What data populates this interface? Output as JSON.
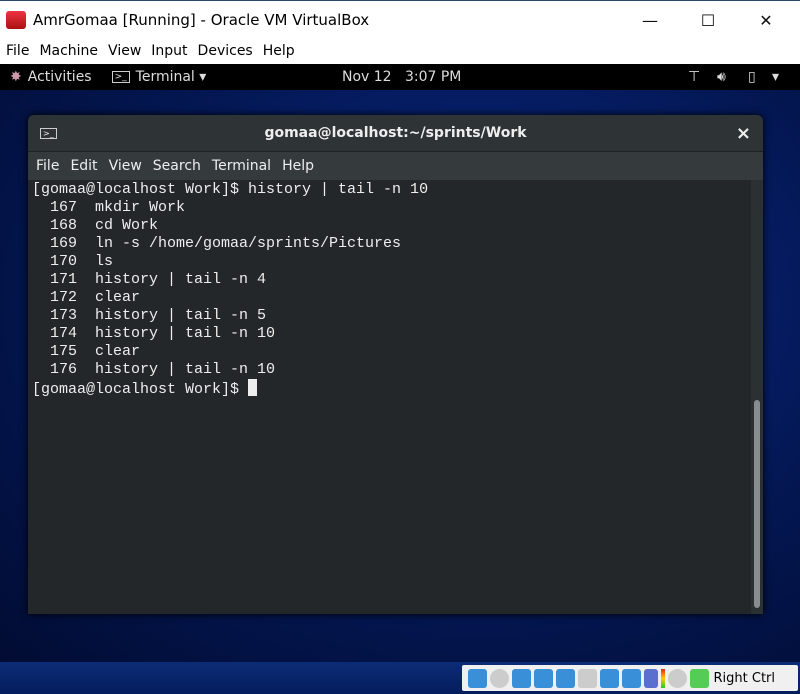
{
  "window": {
    "title": "AmrGomaa [Running] - Oracle VM VirtualBox",
    "minimize": "—",
    "maximize": "☐",
    "close": "✕"
  },
  "vb_menu": [
    "File",
    "Machine",
    "View",
    "Input",
    "Devices",
    "Help"
  ],
  "topbar": {
    "activities": "Activities",
    "app": "Terminal ▾",
    "date": "Nov 12",
    "time": "3:07 PM",
    "menu_arrow": "▾"
  },
  "terminal": {
    "title": "gomaa@localhost:~/sprints/Work",
    "close": "×",
    "menu": [
      "File",
      "Edit",
      "View",
      "Search",
      "Terminal",
      "Help"
    ],
    "lines": [
      "[gomaa@localhost Work]$ history | tail -n 10",
      "  167  mkdir Work",
      "  168  cd Work",
      "  169  ln -s /home/gomaa/sprints/Pictures",
      "  170  ls",
      "  171  history | tail -n 4",
      "  172  clear",
      "  173  history | tail -n 5",
      "  174  history | tail -n 10",
      "  175  clear",
      "  176  history | tail -n 10"
    ],
    "prompt": "[gomaa@localhost Work]$ "
  },
  "statusbar": {
    "host_key": "Right Ctrl"
  }
}
